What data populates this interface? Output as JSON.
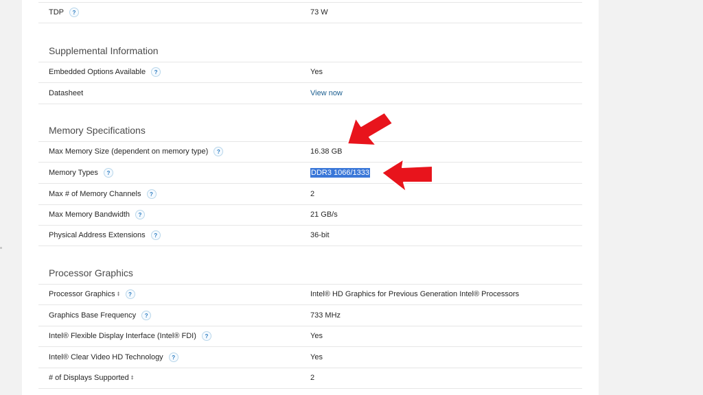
{
  "rows_top": [
    {
      "label": "TDP",
      "value": "73 W",
      "help": true
    }
  ],
  "sections": [
    {
      "title": "Supplemental Information",
      "rows": [
        {
          "label": "Embedded Options Available",
          "value": "Yes",
          "help": true
        },
        {
          "label": "Datasheet",
          "value": "View now",
          "help": false
        }
      ]
    },
    {
      "title": "Memory Specifications",
      "rows": [
        {
          "label": "Max Memory Size (dependent on memory type)",
          "value": "16.38 GB",
          "help": true
        },
        {
          "label": "Memory Types",
          "value": "DDR3 1066/1333",
          "help": true
        },
        {
          "label": "Max # of Memory Channels",
          "value": "2",
          "help": true
        },
        {
          "label": "Max Memory Bandwidth",
          "value": "21 GB/s",
          "help": true
        },
        {
          "label": "Physical Address Extensions",
          "value": "36-bit",
          "help": true
        }
      ]
    },
    {
      "title": "Processor Graphics",
      "rows": [
        {
          "label": "Processor Graphics",
          "value": "Intel® HD Graphics for Previous Generation Intel® Processors",
          "help": true
        },
        {
          "label": "Graphics Base Frequency",
          "value": "733 MHz",
          "help": true
        },
        {
          "label": "Intel® Flexible Display Interface (Intel® FDI)",
          "value": "Yes",
          "help": true
        },
        {
          "label": "Intel® Clear Video HD Technology",
          "value": "Yes",
          "help": true
        },
        {
          "label": "# of Displays Supported",
          "value": "2",
          "help": false
        }
      ]
    }
  ],
  "help_glyph": "?",
  "dagger_glyph": "‡",
  "colors": {
    "arrow": "#e8141c",
    "selection": "#3a77d8",
    "help": "#2b7bbf"
  }
}
